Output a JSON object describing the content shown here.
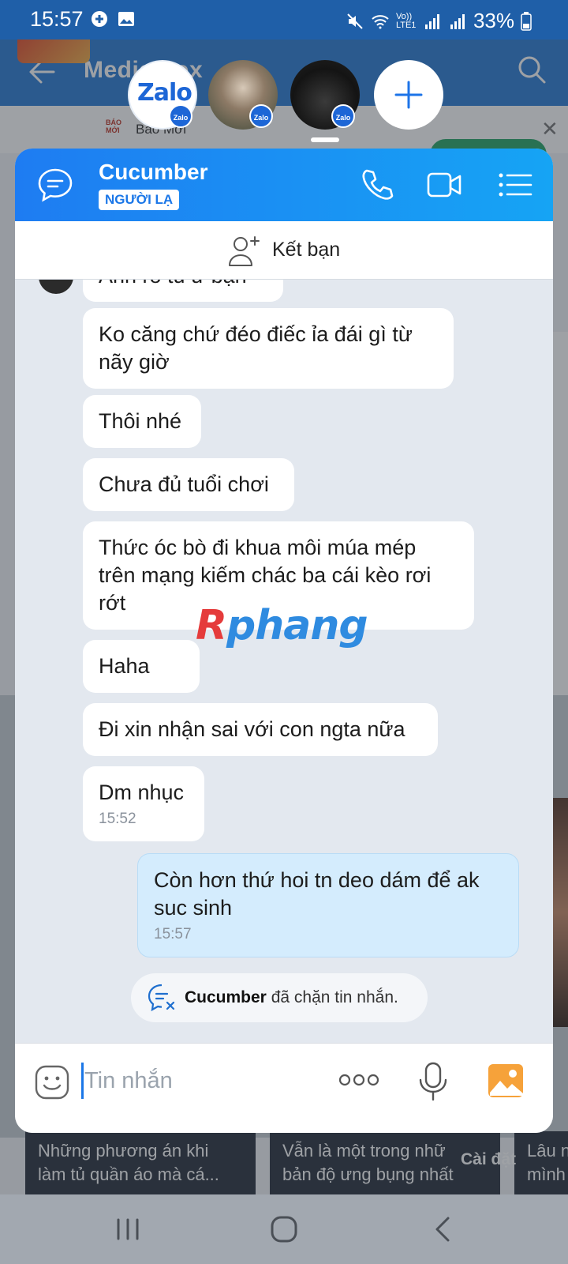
{
  "status_bar": {
    "time": "15:57",
    "network": "Vo)) LTE1",
    "battery": "33%"
  },
  "background_app": {
    "title": "Media box",
    "news_source": "Báo Mới",
    "news_logo": "BÁO MỚI",
    "cards": [
      {
        "line1": "Những phương án khi",
        "line2": "làm tủ quần áo mà cá..."
      },
      {
        "line1": "Vẫn là một trong nhữ",
        "line2": "bản độ ưng bụng nhất"
      },
      {
        "line1": "Lâu n",
        "line2": "mình"
      }
    ],
    "settings_label": "Cài đặt"
  },
  "bubble_heads": {
    "app_name": "Zalo",
    "badge": "Zalo"
  },
  "chat": {
    "name": "Cucumber",
    "badge": "NGƯỜI LẠ",
    "add_friend_label": "Kết bạn",
    "messages": [
      {
        "text": "Anh rồ tủ ư bạn",
        "direction": "in"
      },
      {
        "text": "Ko căng chứ đéo điếc ỉa đái gì từ nãy giờ",
        "direction": "in"
      },
      {
        "text": "Thôi nhé",
        "direction": "in"
      },
      {
        "text": "Chưa đủ tuổi chơi",
        "direction": "in"
      },
      {
        "text": "Thức óc bò đi khua môi múa mép trên mạng kiếm chác ba cái kèo rơi rớt",
        "direction": "in"
      },
      {
        "text": "Haha",
        "direction": "in"
      },
      {
        "text": "Đi xin nhận sai với con ngta nữa",
        "direction": "in"
      },
      {
        "text": "Dm nhục",
        "direction": "in",
        "time": "15:52"
      },
      {
        "text": "Còn hơn thứ hoi tn deo dám để ak suc sinh",
        "direction": "out",
        "time": "15:57"
      }
    ],
    "blocked_notice": {
      "name": "Cucumber",
      "text": "đã chặn tin nhắn."
    },
    "composer": {
      "placeholder": "Tin nhắn"
    }
  },
  "watermark": {
    "first": "R",
    "rest": "phang"
  },
  "colors": {
    "header_gradient_start": "#1e7cf2",
    "header_gradient_end": "#16a4f4",
    "incoming_bubble": "#ffffff",
    "outgoing_bubble": "#d4ecfd",
    "accent": "#1b77e8"
  }
}
